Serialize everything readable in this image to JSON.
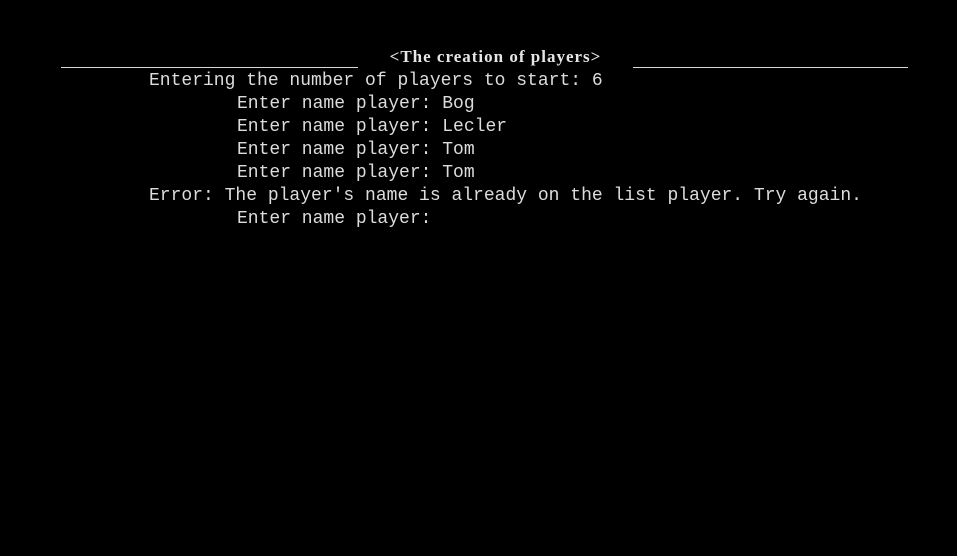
{
  "header": {
    "title": "<The creation of players>"
  },
  "console": {
    "lines": [
      "Entering the number of players to start: 6",
      "Enter name player: Bog",
      "Enter name player: Lecler",
      "Enter name player: Tom",
      "Enter name player: Tom",
      "Error: The player's name is already on the list player. Try again.",
      "Enter name player:"
    ]
  }
}
